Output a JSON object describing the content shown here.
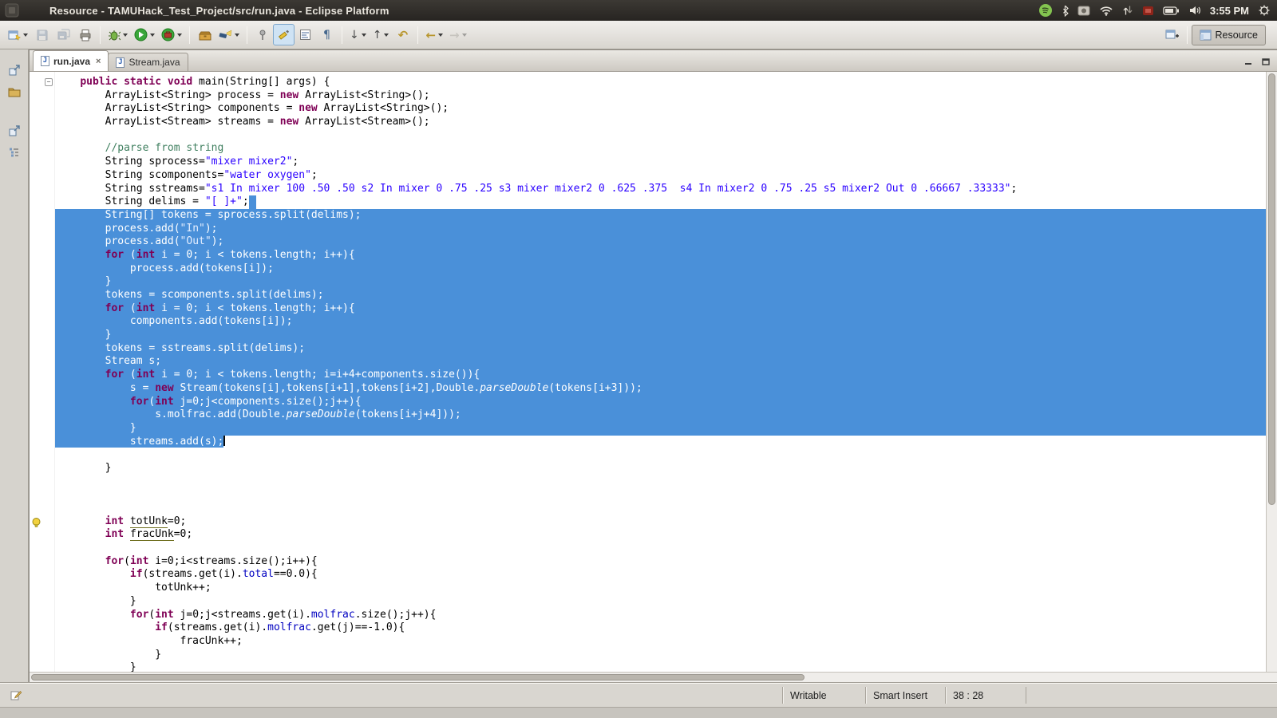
{
  "colors": {
    "selection": "#4a90d9",
    "keyword": "#7f0055",
    "string": "#2a00ff",
    "comment": "#3f7f5f",
    "field": "#0000c0",
    "panel_bg": "#2f2c28",
    "toolbar_bg": "#d8d5cf"
  },
  "window": {
    "title": "Resource - TAMUHack_Test_Project/src/run.java - Eclipse Platform"
  },
  "panel": {
    "clock": "3:55 PM",
    "tray_icons": [
      "spotify",
      "bluetooth",
      "camera",
      "wifi",
      "network-traffic",
      "recorder",
      "battery",
      "volume",
      "session-menu"
    ]
  },
  "toolbar": {
    "buttons": [
      "new-wizard",
      "save",
      "save-all",
      "print",
      "debug",
      "run",
      "external-tools",
      "toolbox",
      "search",
      "pin-editor",
      "mark-occurrences",
      "show-selected-element",
      "show-whitespace",
      "next-annotation",
      "previous-annotation",
      "last-edit-location",
      "back",
      "forward",
      "open-perspective"
    ],
    "pressed_button": "mark-occurrences",
    "perspective_label": "Resource"
  },
  "left_trim": [
    "restore-view",
    "project-explorer",
    "restore-view",
    "outline"
  ],
  "tabs": [
    {
      "label": "run.java",
      "active": true,
      "closable": true
    },
    {
      "label": "Stream.java",
      "active": false,
      "closable": false
    }
  ],
  "icons": {
    "java_file": "J",
    "close": "×",
    "pilcrow": "¶",
    "down_arrow": "↓",
    "up_arrow": "↑",
    "undo_arrow": "↶",
    "back_arrow": "←",
    "forward_arrow": "→",
    "fold_minus": "−"
  },
  "status": {
    "writable": "Writable",
    "insert_mode": "Smart Insert",
    "caret_position": "38 : 28"
  },
  "editor": {
    "warning_line": 34,
    "fold_line": 1,
    "lines": [
      {
        "segs": [
          [
            "    ",
            "d"
          ],
          [
            "public static void",
            "k"
          ],
          [
            " main(String[] args) {",
            "d"
          ]
        ]
      },
      {
        "segs": [
          [
            "        ArrayList<String> process = ",
            "d"
          ],
          [
            "new",
            "k"
          ],
          [
            " ArrayList<String>();",
            "d"
          ]
        ]
      },
      {
        "segs": [
          [
            "        ArrayList<String> components = ",
            "d"
          ],
          [
            "new",
            "k"
          ],
          [
            " ArrayList<String>();",
            "d"
          ]
        ]
      },
      {
        "segs": [
          [
            "        ArrayList<Stream> streams = ",
            "d"
          ],
          [
            "new",
            "k"
          ],
          [
            " ArrayList<Stream>();",
            "d"
          ]
        ]
      },
      {
        "segs": []
      },
      {
        "segs": [
          [
            "        ",
            "d"
          ],
          [
            "//parse from string",
            "c"
          ]
        ]
      },
      {
        "segs": [
          [
            "        String sprocess=",
            "d"
          ],
          [
            "\"mixer mixer2\"",
            "s"
          ],
          [
            ";",
            "d"
          ]
        ]
      },
      {
        "segs": [
          [
            "        String scomponents=",
            "d"
          ],
          [
            "\"water oxygen\"",
            "s"
          ],
          [
            ";",
            "d"
          ]
        ]
      },
      {
        "segs": [
          [
            "        String sstreams=",
            "d"
          ],
          [
            "\"s1 In mixer 100 .50 .50 s2 In mixer 0 .75 .25 s3 mixer mixer2 0 .625 .375  s4 In mixer2 0 .75 .25 s5 mixer2 Out 0 .66667 .33333\"",
            "s"
          ],
          [
            ";",
            "d"
          ]
        ]
      },
      {
        "sel": "eol",
        "segs": [
          [
            "        String delims = ",
            "d"
          ],
          [
            "\"[ ]+\"",
            "s"
          ],
          [
            ";",
            "d"
          ]
        ]
      },
      {
        "sel": "full",
        "segs": [
          [
            "        String[] tokens = sprocess.split(delims);",
            "d"
          ]
        ]
      },
      {
        "sel": "full",
        "segs": [
          [
            "        process.add(",
            "d"
          ],
          [
            "\"In\"",
            "s"
          ],
          [
            ");",
            "d"
          ]
        ]
      },
      {
        "sel": "full",
        "segs": [
          [
            "        process.add(",
            "d"
          ],
          [
            "\"Out\"",
            "s"
          ],
          [
            ");",
            "d"
          ]
        ]
      },
      {
        "sel": "full",
        "segs": [
          [
            "        ",
            "d"
          ],
          [
            "for",
            "k"
          ],
          [
            " (",
            "d"
          ],
          [
            "int",
            "k"
          ],
          [
            " i = 0; i < tokens.length; i++){",
            "d"
          ]
        ]
      },
      {
        "sel": "full",
        "segs": [
          [
            "            process.add(tokens[i]);",
            "d"
          ]
        ]
      },
      {
        "sel": "full",
        "segs": [
          [
            "        }",
            "d"
          ]
        ]
      },
      {
        "sel": "full",
        "segs": [
          [
            "        tokens = scomponents.split(delims);",
            "d"
          ]
        ]
      },
      {
        "sel": "full",
        "segs": [
          [
            "        ",
            "d"
          ],
          [
            "for",
            "k"
          ],
          [
            " (",
            "d"
          ],
          [
            "int",
            "k"
          ],
          [
            " i = 0; i < tokens.length; i++){",
            "d"
          ]
        ]
      },
      {
        "sel": "full",
        "segs": [
          [
            "            components.add(tokens[i]);",
            "d"
          ]
        ]
      },
      {
        "sel": "full",
        "segs": [
          [
            "        }",
            "d"
          ]
        ]
      },
      {
        "sel": "full",
        "segs": [
          [
            "        tokens = sstreams.split(delims);",
            "d"
          ]
        ]
      },
      {
        "sel": "full",
        "segs": [
          [
            "        Stream s;",
            "d"
          ]
        ]
      },
      {
        "sel": "full",
        "segs": [
          [
            "        ",
            "d"
          ],
          [
            "for",
            "k"
          ],
          [
            " (",
            "d"
          ],
          [
            "int",
            "k"
          ],
          [
            " i = 0; i < tokens.length; i=i+4+components.size()){",
            "d"
          ]
        ]
      },
      {
        "sel": "full",
        "segs": [
          [
            "            s = ",
            "d"
          ],
          [
            "new",
            "k"
          ],
          [
            " Stream(tokens[i],tokens[i+1],tokens[i+2],Double.",
            "d"
          ],
          [
            "parseDouble",
            "m"
          ],
          [
            "(tokens[i+3]));",
            "d"
          ]
        ]
      },
      {
        "sel": "full",
        "segs": [
          [
            "            ",
            "d"
          ],
          [
            "for",
            "k"
          ],
          [
            "(",
            "d"
          ],
          [
            "int",
            "k"
          ],
          [
            " j=0;j<components.size();j++){",
            "d"
          ]
        ]
      },
      {
        "sel": "full",
        "segs": [
          [
            "                s.",
            "d"
          ],
          [
            "molfrac",
            "f"
          ],
          [
            ".add(Double.",
            "d"
          ],
          [
            "parseDouble",
            "m"
          ],
          [
            "(tokens[i+j+4]));",
            "d"
          ]
        ]
      },
      {
        "sel": "full",
        "segs": [
          [
            "            }",
            "d"
          ]
        ]
      },
      {
        "sel": "text",
        "caret": true,
        "segs": [
          [
            "            streams.add(s);",
            "d"
          ]
        ]
      },
      {
        "segs": []
      },
      {
        "segs": [
          [
            "        }",
            "d"
          ]
        ]
      },
      {
        "segs": []
      },
      {
        "segs": []
      },
      {
        "segs": []
      },
      {
        "segs": [
          [
            "        ",
            "d"
          ],
          [
            "int",
            "k"
          ],
          [
            " ",
            "d"
          ],
          [
            "totUnk",
            "w"
          ],
          [
            "=0;",
            "d"
          ]
        ]
      },
      {
        "segs": [
          [
            "        ",
            "d"
          ],
          [
            "int",
            "k"
          ],
          [
            " ",
            "d"
          ],
          [
            "fracUnk",
            "w"
          ],
          [
            "=0;",
            "d"
          ]
        ]
      },
      {
        "segs": []
      },
      {
        "segs": [
          [
            "        ",
            "d"
          ],
          [
            "for",
            "k"
          ],
          [
            "(",
            "d"
          ],
          [
            "int",
            "k"
          ],
          [
            " i=0;i<streams.size();i++){",
            "d"
          ]
        ]
      },
      {
        "segs": [
          [
            "            ",
            "d"
          ],
          [
            "if",
            "k"
          ],
          [
            "(streams.get(i).",
            "d"
          ],
          [
            "total",
            "f"
          ],
          [
            "==0.0){",
            "d"
          ]
        ]
      },
      {
        "segs": [
          [
            "                totUnk++;",
            "d"
          ]
        ]
      },
      {
        "segs": [
          [
            "            }",
            "d"
          ]
        ]
      },
      {
        "segs": [
          [
            "            ",
            "d"
          ],
          [
            "for",
            "k"
          ],
          [
            "(",
            "d"
          ],
          [
            "int",
            "k"
          ],
          [
            " j=0;j<streams.get(i).",
            "d"
          ],
          [
            "molfrac",
            "f"
          ],
          [
            ".size();j++){",
            "d"
          ]
        ]
      },
      {
        "segs": [
          [
            "                ",
            "d"
          ],
          [
            "if",
            "k"
          ],
          [
            "(streams.get(i).",
            "d"
          ],
          [
            "molfrac",
            "f"
          ],
          [
            ".get(j)==-1.0){",
            "d"
          ]
        ]
      },
      {
        "segs": [
          [
            "                    fracUnk++;",
            "d"
          ]
        ]
      },
      {
        "segs": [
          [
            "                }",
            "d"
          ]
        ]
      },
      {
        "segs": [
          [
            "            }",
            "d"
          ]
        ]
      }
    ]
  }
}
